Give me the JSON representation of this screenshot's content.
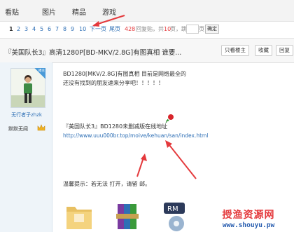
{
  "nav": {
    "tabs": [
      "看贴",
      "图片",
      "精品",
      "游戏"
    ]
  },
  "pager": {
    "pages": [
      "1",
      "2",
      "3",
      "4",
      "5",
      "6",
      "7",
      "8",
      "9",
      "10"
    ],
    "next_label": "下一页",
    "last_label": "尾页",
    "reply_count": "428",
    "reply_suffix": "回复贴，共",
    "page_total": "10",
    "page_suffix": "页，跳到",
    "page_unit": "页",
    "confirm_label": "确定"
  },
  "thread": {
    "title": "『美国队长3』高清1280P[BD-MKV/2.8G]有图真相 谁要...",
    "buttons": [
      "只看楼主",
      "收藏",
      "回复"
    ]
  },
  "author": {
    "badge": "楼主",
    "username": "无行者子zhzk",
    "rank_label": "默默无闻"
  },
  "post": {
    "line1": "BD1280[MKV/2.8G]有图真相 目前是网络最全的",
    "line2": "还没有找到的朋友速来分享吧！！！！！",
    "line3": "『美国队长3』BD1280未删减版在线地址",
    "link": "http://www.uuu000br.top/moive/kehuan/san/index.html",
    "tip": "温馨提示：若无法 打开，请留 邮。"
  },
  "watermark": {
    "line1": "授渔资源网",
    "line2": "www.shouyu.pw"
  },
  "colors": {
    "link": "#2e6fb5",
    "accent_red": "#e4393c",
    "brand_blue": "#2a5fb0"
  }
}
